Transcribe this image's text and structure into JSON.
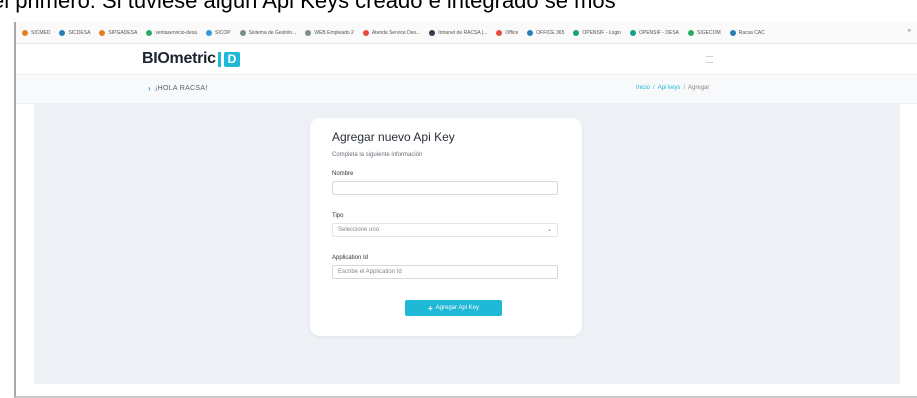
{
  "document": {
    "caption": "el primero. Si tuviese algún Api Keys creado e integrado se mos"
  },
  "bookmarks": [
    {
      "label": "SICMED",
      "color": "#e67e22"
    },
    {
      "label": "SICDESA",
      "color": "#2980b9"
    },
    {
      "label": "SIPGADESA",
      "color": "#e67e22"
    },
    {
      "label": "ventaservicio-desa",
      "color": "#27ae60"
    },
    {
      "label": "SICOP",
      "color": "#3498db"
    },
    {
      "label": "Sistema de Gestión...",
      "color": "#7f8c8d"
    },
    {
      "label": "WEB Empleado 2",
      "color": "#7f8c8d"
    },
    {
      "label": "Atenda Service Des...",
      "color": "#e74c3c"
    },
    {
      "label": "Intranet de RACSA |...",
      "color": "#2c3e50"
    },
    {
      "label": "Office",
      "color": "#e74c3c"
    },
    {
      "label": "OFFICE 365",
      "color": "#2980b9"
    },
    {
      "label": "OPENSIF - Login",
      "color": "#16a085"
    },
    {
      "label": "OPENSIF - DESA",
      "color": "#16a085"
    },
    {
      "label": "SIGECOM",
      "color": "#27ae60"
    },
    {
      "label": "Racsa CAC",
      "color": "#2980b9"
    }
  ],
  "bookmarks_more": "»",
  "header": {
    "logo_text": "BIOmetric",
    "logo_badge": "D"
  },
  "greeting": {
    "text": "¡HOLA RACSA!"
  },
  "breadcrumb": {
    "home": "Inicio",
    "sep": "/",
    "section": "Api keys",
    "current": "Agregar"
  },
  "form": {
    "title": "Agregar nuevo Api Key",
    "subtitle": "Completa la siguiente información",
    "name_label": "Nombre",
    "name_value": "",
    "type_label": "Tipo",
    "type_selected": "Seleccione uno",
    "appid_label": "Application Id",
    "appid_placeholder": "Escribe el Application Id",
    "submit_label": "Agregar Api Key"
  },
  "colors": {
    "accent": "#1fb8d6",
    "background": "#edf0f4"
  }
}
